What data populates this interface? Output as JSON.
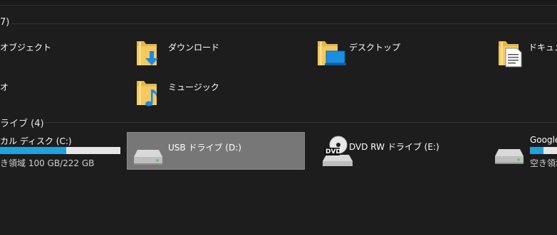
{
  "groups": {
    "folders_header": "7)",
    "devices_header": "ライブ (4)"
  },
  "folders": [
    {
      "label": "オブジェクト"
    },
    {
      "label": "ダウンロード"
    },
    {
      "label": "デスクトップ"
    },
    {
      "label": "ドキュメン"
    },
    {
      "label": "オ"
    },
    {
      "label": "ミュージック"
    }
  ],
  "drives": [
    {
      "label": "カル ディスク (C:)",
      "free_text": "き領域 100 GB/222 GB",
      "usage_fraction": 0.55
    },
    {
      "label": "USB ドライブ (D:)",
      "selected": true
    },
    {
      "label": "DVD RW ドライブ (E:)",
      "dvd_badge": "DVD"
    },
    {
      "label": "Google",
      "free_text": "空き領域",
      "usage_fraction": 0.5
    }
  ],
  "colors": {
    "background": "#1d1d1d",
    "usage_bar": "#26a0da",
    "selection": "#777777",
    "folder_yellow": "#f4c95d"
  },
  "icons": [
    "folder-icon",
    "download-arrow-icon",
    "desktop-monitor-icon",
    "document-icon",
    "music-note-icon",
    "drive-icon",
    "dvd-disc-icon"
  ]
}
